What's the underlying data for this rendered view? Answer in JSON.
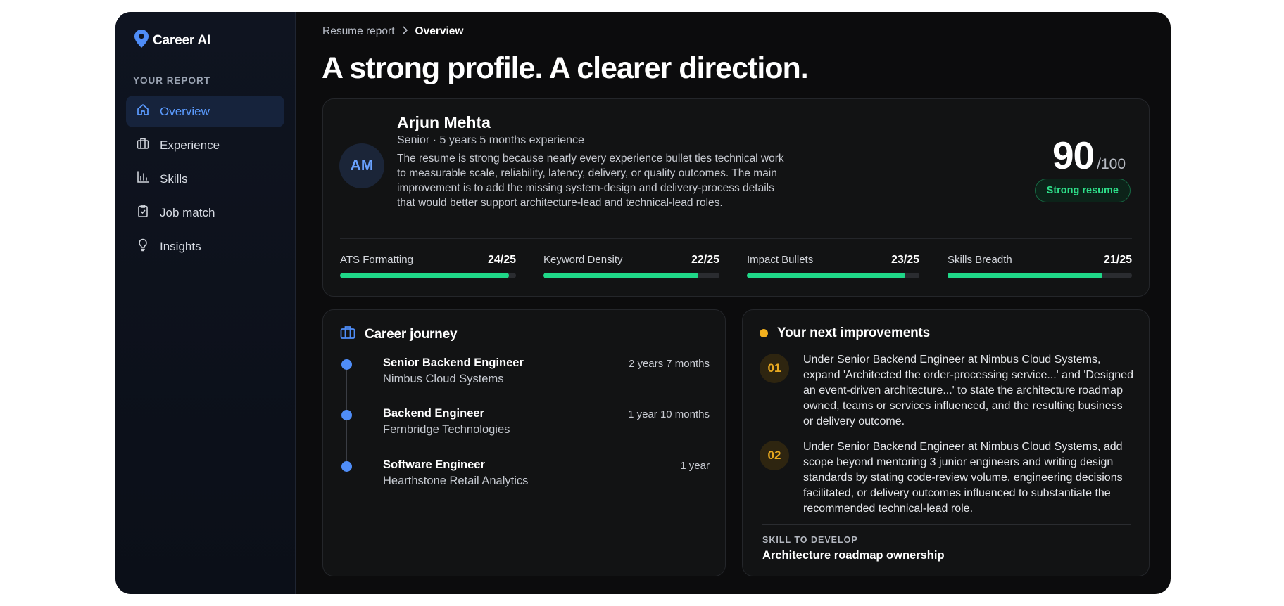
{
  "app": {
    "brand": "Career AI"
  },
  "sidebar": {
    "section_label": "YOUR REPORT",
    "items": [
      {
        "label": "Overview",
        "icon": "home-icon",
        "active": true
      },
      {
        "label": "Experience",
        "icon": "briefcase-icon",
        "active": false
      },
      {
        "label": "Skills",
        "icon": "bar-chart-icon",
        "active": false
      },
      {
        "label": "Job match",
        "icon": "clipboard-check-icon",
        "active": false
      },
      {
        "label": "Insights",
        "icon": "lightbulb-icon",
        "active": false
      }
    ]
  },
  "breadcrumb": {
    "parent": "Resume report",
    "current": "Overview"
  },
  "headline": "A strong profile. A clearer direction.",
  "profile": {
    "initials": "AM",
    "name": "Arjun Mehta",
    "subtitle": "Senior · 5 years 5 months experience",
    "description": "The resume is strong because nearly every experience bullet ties technical work to measurable scale, reliability, latency, delivery, or quality outcomes. The main improvement is to add the missing system-design and delivery-process details that would better support architecture-lead and technical-lead roles.",
    "score": "90",
    "score_max": "/100",
    "badge": "Strong resume"
  },
  "metrics": [
    {
      "label": "ATS Formatting",
      "value": "24/25",
      "fraction": 0.96
    },
    {
      "label": "Keyword Density",
      "value": "22/25",
      "fraction": 0.88
    },
    {
      "label": "Impact Bullets",
      "value": "23/25",
      "fraction": 0.92
    },
    {
      "label": "Skills Breadth",
      "value": "21/25",
      "fraction": 0.84
    }
  ],
  "journey": {
    "title": "Career journey",
    "jobs": [
      {
        "title": "Senior Backend Engineer",
        "company": "Nimbus Cloud Systems",
        "duration": "2 years 7 months"
      },
      {
        "title": "Backend Engineer",
        "company": "Fernbridge Technologies",
        "duration": "1 year 10 months"
      },
      {
        "title": "Software Engineer",
        "company": "Hearthstone Retail Analytics",
        "duration": "1 year"
      }
    ]
  },
  "improvements": {
    "title": "Your next improvements",
    "items": [
      {
        "num": "01",
        "text": "Under Senior Backend Engineer at Nimbus Cloud Systems, expand 'Architected the order-processing service...' and 'Designed an event-driven architecture...' to state the architecture roadmap owned, teams or services influenced, and the resulting business or delivery outcome."
      },
      {
        "num": "02",
        "text": "Under Senior Backend Engineer at Nimbus Cloud Systems, add scope beyond mentoring 3 junior engineers and writing design standards by stating code-review volume, engineering decisions facilitated, or delivery outcomes influenced to substantiate the recommended technical-lead role."
      }
    ],
    "skill_label": "SKILL TO DEVELOP",
    "skill_value": "Architecture roadmap ownership"
  },
  "colors": {
    "accent_blue": "#5b9bff",
    "success_green": "#1fd888",
    "warning_amber": "#f2b01e"
  }
}
